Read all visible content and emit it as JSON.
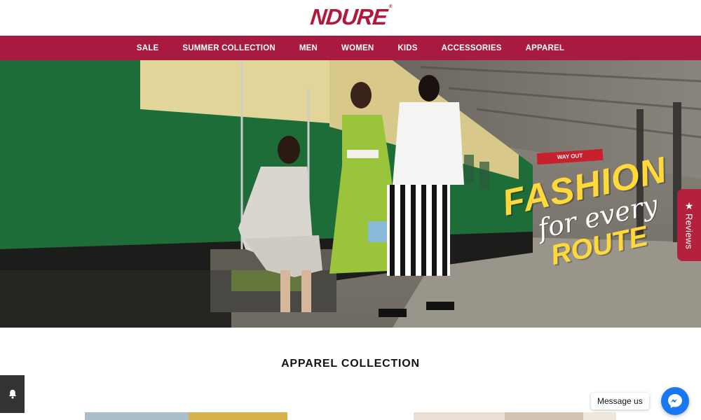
{
  "brand": {
    "logo_text": "NDURE",
    "logo_mark": "®",
    "color": "#b0193b"
  },
  "nav": {
    "items": [
      {
        "label": "SALE"
      },
      {
        "label": "SUMMER COLLECTION"
      },
      {
        "label": "MEN"
      },
      {
        "label": "WOMEN"
      },
      {
        "label": "KIDS"
      },
      {
        "label": "ACCESSORIES"
      },
      {
        "label": "APPAREL"
      }
    ],
    "background": "#a81a3f"
  },
  "hero": {
    "line1": "FASHION",
    "line2": "for every",
    "line3": "ROUTE",
    "sign_text": "WAY OUT",
    "slide_count": 4,
    "active_slide": 1
  },
  "reviews_tab": {
    "label": "Reviews",
    "icon": "star-icon"
  },
  "collection": {
    "title": "APPAREL COLLECTION"
  },
  "messenger": {
    "label": "Message us",
    "icon": "messenger-icon"
  },
  "notification": {
    "icon": "bell-icon"
  }
}
